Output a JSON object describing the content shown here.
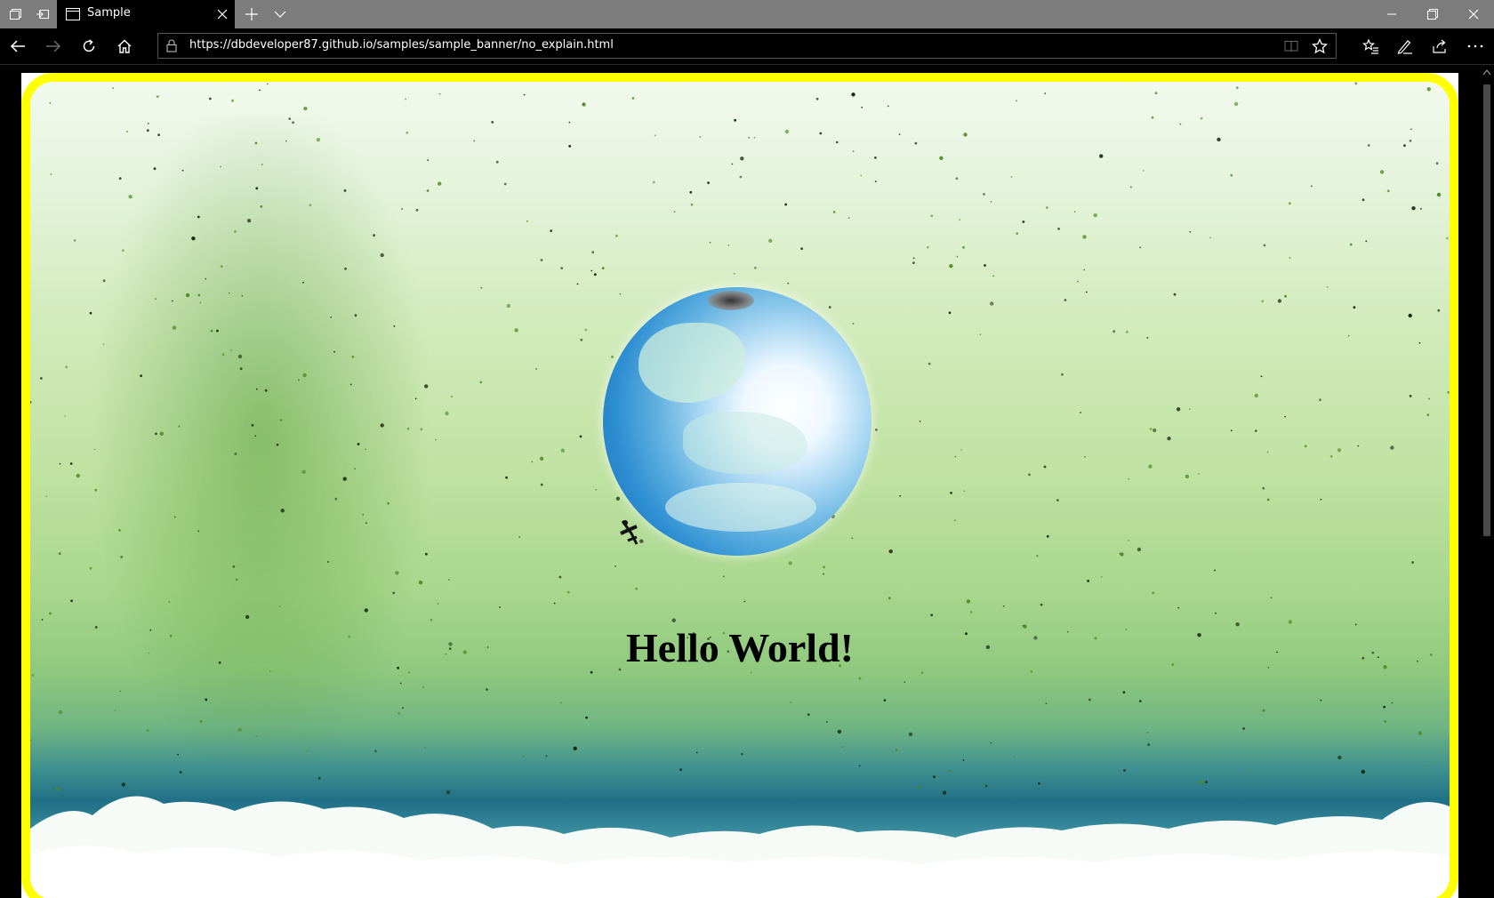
{
  "browser": {
    "tab": {
      "title": "Sample"
    },
    "address": {
      "url": "https://dbdeveloper87.github.io/samples/sample_banner/no_explain.html"
    }
  },
  "page": {
    "banner": {
      "headline": "Hello World!",
      "border_color": "#ffff00"
    }
  },
  "icons": [
    "tab-actions-icon",
    "tabs-aside-icon",
    "page-icon",
    "close-tab-icon",
    "new-tab-icon",
    "tab-list-chevron-icon",
    "minimize-icon",
    "restore-icon",
    "close-window-icon",
    "back-icon",
    "forward-icon",
    "refresh-icon",
    "home-icon",
    "lock-icon",
    "reading-view-icon",
    "favorite-star-icon",
    "favorites-hub-icon",
    "pen-icon",
    "share-icon",
    "more-icon"
  ]
}
